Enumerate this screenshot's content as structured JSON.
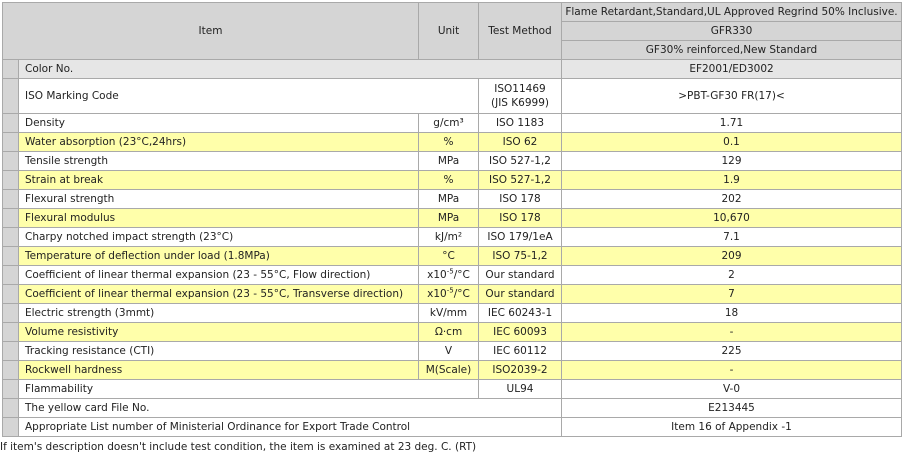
{
  "header": {
    "item": "Item",
    "unit": "Unit",
    "test_method": "Test Method",
    "grade_desc": "Flame Retardant,Standard,UL Approved Regrind 50% Inclusive.",
    "grade": "GFR330",
    "grade_sub": "GF30% reinforced,New Standard"
  },
  "rows": [
    {
      "item": "Color No.",
      "unit": "",
      "method": "",
      "value": "EF2001/ED3002"
    },
    {
      "item": "ISO Marking Code",
      "unit": "",
      "method": "ISO11469",
      "method2": "(JIS K6999)",
      "value": ">PBT-GF30 FR(17)<"
    },
    {
      "item": "Density",
      "unit": "g/cm³",
      "method": "ISO 1183",
      "value": "1.71"
    },
    {
      "item": "Water absorption (23°C,24hrs)",
      "unit": "%",
      "method": "ISO 62",
      "value": "0.1"
    },
    {
      "item": "Tensile strength",
      "unit": "MPa",
      "method": "ISO 527-1,2",
      "value": "129"
    },
    {
      "item": "Strain at break",
      "unit": "%",
      "method": "ISO 527-1,2",
      "value": "1.9"
    },
    {
      "item": "Flexural strength",
      "unit": "MPa",
      "method": "ISO 178",
      "value": "202"
    },
    {
      "item": "Flexural modulus",
      "unit": "MPa",
      "method": "ISO 178",
      "value": "10,670"
    },
    {
      "item": "Charpy notched impact strength (23°C)",
      "unit": "kJ/m²",
      "method": "ISO 179/1eA",
      "value": "7.1"
    },
    {
      "item": "Temperature of deflection under load (1.8MPa)",
      "unit": "°C",
      "method": "ISO 75-1,2",
      "value": "209"
    },
    {
      "item": "Coefficient of linear thermal expansion (23 - 55°C, Flow direction)",
      "unit": "x10",
      "unit_sup": "-5",
      "unit_tail": "/°C",
      "method": "Our standard",
      "value": "2"
    },
    {
      "item": "Coefficient of linear thermal expansion (23 - 55°C, Transverse direction)",
      "unit": "x10",
      "unit_sup": "-5",
      "unit_tail": "/°C",
      "method": "Our standard",
      "value": "7"
    },
    {
      "item": "Electric strength (3mmt)",
      "unit": "kV/mm",
      "method": "IEC 60243-1",
      "value": "18"
    },
    {
      "item": "Volume resistivity",
      "unit": "Ω·cm",
      "method": "IEC 60093",
      "value": "-"
    },
    {
      "item": "Tracking resistance (CTI)",
      "unit": "V",
      "method": "IEC 60112",
      "value": "225"
    },
    {
      "item": "Rockwell hardness",
      "unit": "M(Scale)",
      "method": "ISO2039-2",
      "value": "-"
    },
    {
      "item": "Flammability",
      "unit": "",
      "method": "UL94",
      "value": "V-0"
    },
    {
      "item": "The yellow card File No.",
      "unit": "",
      "method": "",
      "value": "E213445"
    },
    {
      "item": "Appropriate List number of Ministerial Ordinance for Export Trade Control",
      "unit": "",
      "method": "",
      "value": "Item 16 of Appendix -1"
    }
  ],
  "footnote": "If item's description doesn't include test condition, the item is examined at 23 deg. C. (RT)"
}
